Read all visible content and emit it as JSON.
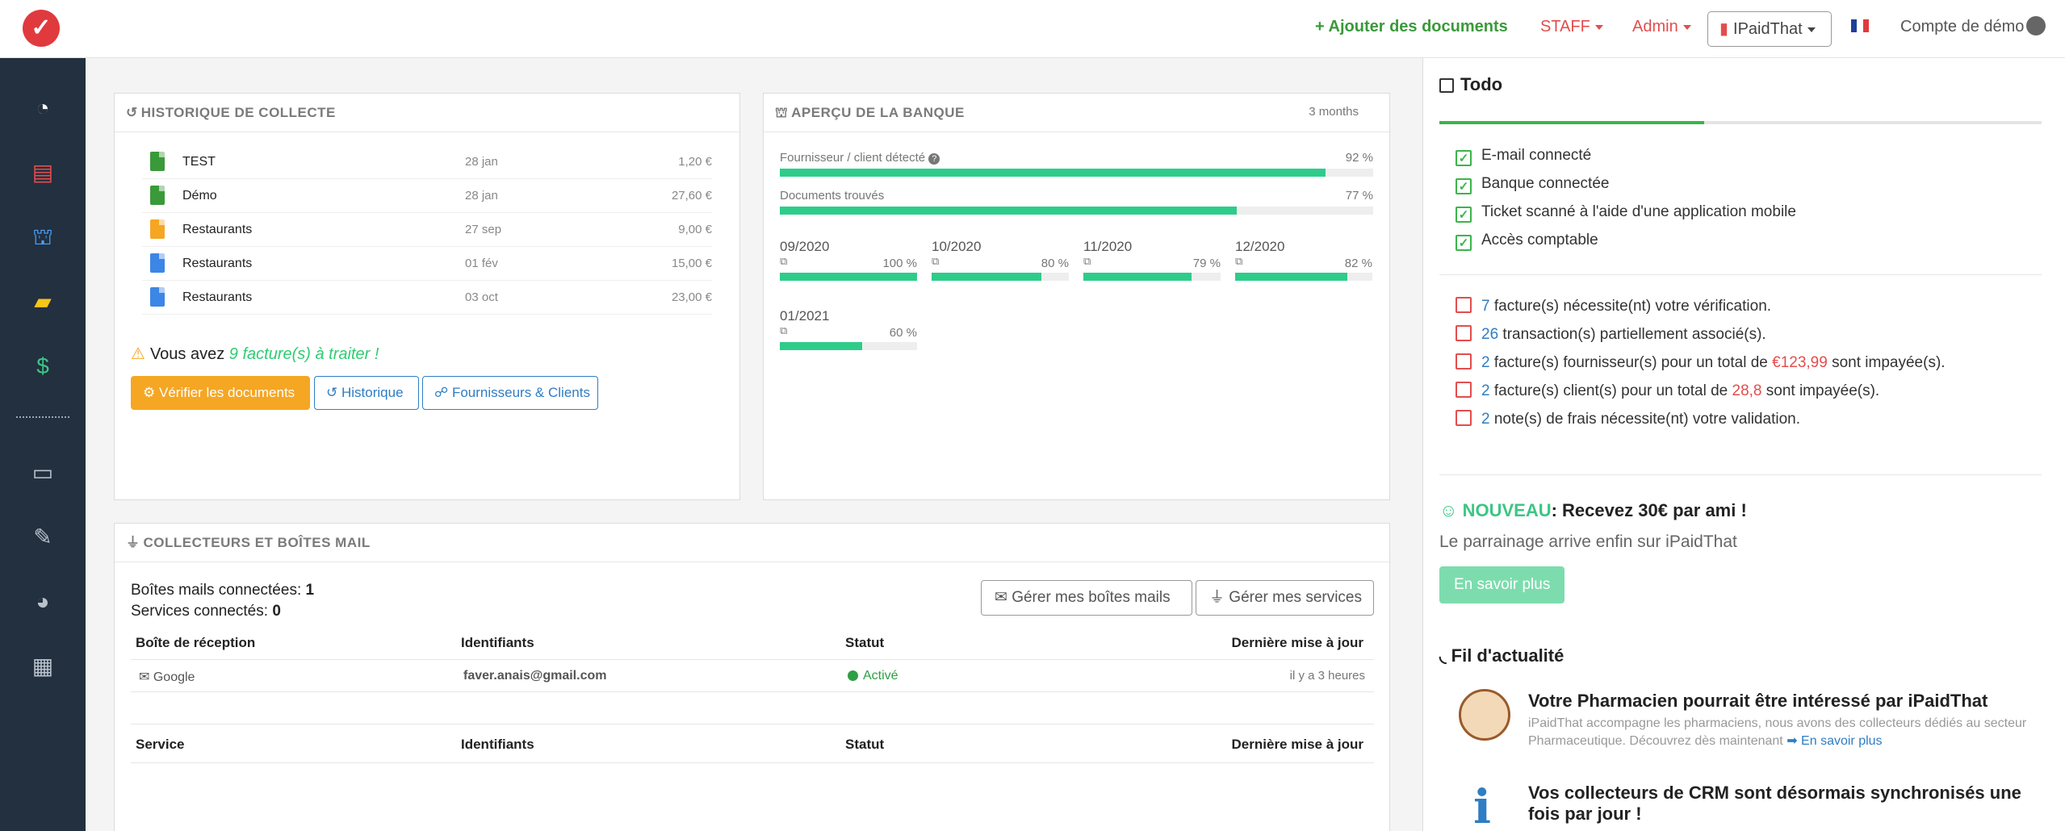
{
  "topbar": {
    "logo_glyph": "✓",
    "add_documents": "Ajouter des documents",
    "staff": "STAFF",
    "admin": "Admin",
    "company": "IPaidThat",
    "demo_account": "Compte de démo"
  },
  "sidebar": {
    "items": [
      "dashboard-icon",
      "documents-icon",
      "bank-icon",
      "taxi-icon",
      "invoice-icon",
      "folder-icon",
      "wrench-icon",
      "pie-chart-icon",
      "calculator-icon"
    ]
  },
  "history": {
    "title": "HISTORIQUE DE COLLECTE",
    "rows": [
      {
        "name": "TEST",
        "date": "28 jan",
        "amount": "1,20 €",
        "color": "#3a9a3a"
      },
      {
        "name": "Démo",
        "date": "28 jan",
        "amount": "27,60 €",
        "color": "#3a9a3a"
      },
      {
        "name": "Restaurants",
        "date": "27 sep",
        "amount": "9,00 €",
        "color": "#f5a623"
      },
      {
        "name": "Restaurants",
        "date": "01 fév",
        "amount": "15,00 €",
        "color": "#3b86e6"
      },
      {
        "name": "Restaurants",
        "date": "03 oct",
        "amount": "23,00 €",
        "color": "#3b86e6"
      }
    ],
    "warning_prefix": "Vous avez",
    "warning_link": "9 facture(s) à traiter !",
    "btn_verify": "Vérifier les documents",
    "btn_history": "Historique",
    "btn_suppliers": "Fournisseurs & Clients"
  },
  "bank": {
    "title": "APERÇU DE LA BANQUE",
    "period": "3 months",
    "supplier_label": "Fournisseur / client détecté",
    "supplier_pct": "92 %",
    "supplier_value": 92,
    "docs_label": "Documents trouvés",
    "docs_pct": "77 %",
    "docs_value": 77,
    "months": [
      {
        "label": "09/2020",
        "pct": "100 %",
        "value": 100
      },
      {
        "label": "10/2020",
        "pct": "80 %",
        "value": 80
      },
      {
        "label": "11/2020",
        "pct": "79 %",
        "value": 79
      },
      {
        "label": "12/2020",
        "pct": "82 %",
        "value": 82
      },
      {
        "label": "01/2021",
        "pct": "60 %",
        "value": 60
      }
    ]
  },
  "collectors": {
    "title": "COLLECTEURS ET BOÎTES MAIL",
    "mailboxes_label": "Boîtes mails connectées:",
    "mailboxes_count": "1",
    "services_label": "Services connectés:",
    "services_count": "0",
    "btn_mailboxes": "Gérer mes boîtes mails",
    "btn_services": "Gérer mes services",
    "inbox_headers": [
      "Boîte de réception",
      "Identifiants",
      "Statut",
      "Dernière mise à jour"
    ],
    "inbox_row": {
      "provider": "Google",
      "identifier": "faver.anais@gmail.com",
      "status": "Activé",
      "updated": "il y a 3 heures"
    },
    "service_headers": [
      "Service",
      "Identifiants",
      "Statut",
      "Dernière mise à jour"
    ]
  },
  "todo": {
    "title": "Todo",
    "progress": 0.44,
    "done": [
      "E-mail connecté",
      "Banque connectée",
      "Ticket scanné à l'aide d'une application mobile",
      "Accès comptable"
    ],
    "pending": [
      {
        "num": "7",
        "text": "facture(s) nécessite(nt) votre vérification."
      },
      {
        "num": "26",
        "text": "transaction(s) partiellement associé(s)."
      },
      {
        "num": "2",
        "text_a": "facture(s) fournisseur(s) pour un total de",
        "amount": "€123,99",
        "text_b": "sont impayée(s)."
      },
      {
        "num": "2",
        "text_a": "facture(s) client(s) pour un total de",
        "amount": "28,8",
        "text_b": "sont impayée(s)."
      },
      {
        "num": "2",
        "text": "note(s) de frais nécessite(nt) votre validation."
      }
    ]
  },
  "promo": {
    "new_label": "NOUVEAU",
    "title_a": ": Recevez",
    "title_amount": "30€",
    "title_b": "par ami !",
    "subtitle": "Le parrainage arrive enfin sur iPaidThat",
    "button": "En savoir plus"
  },
  "feed": {
    "title": "Fil d'actualité",
    "item1_title": "Votre Pharmacien pourrait être intéressé par iPaidThat",
    "item1_body": "iPaidThat accompagne les pharmaciens, nous avons des collecteurs dédiés au secteur Pharmaceutique. Découvrez dès maintenant",
    "item1_more": "En savoir plus",
    "item2_title": "Vos collecteurs de CRM sont désormais synchronisés une fois par jour !"
  }
}
